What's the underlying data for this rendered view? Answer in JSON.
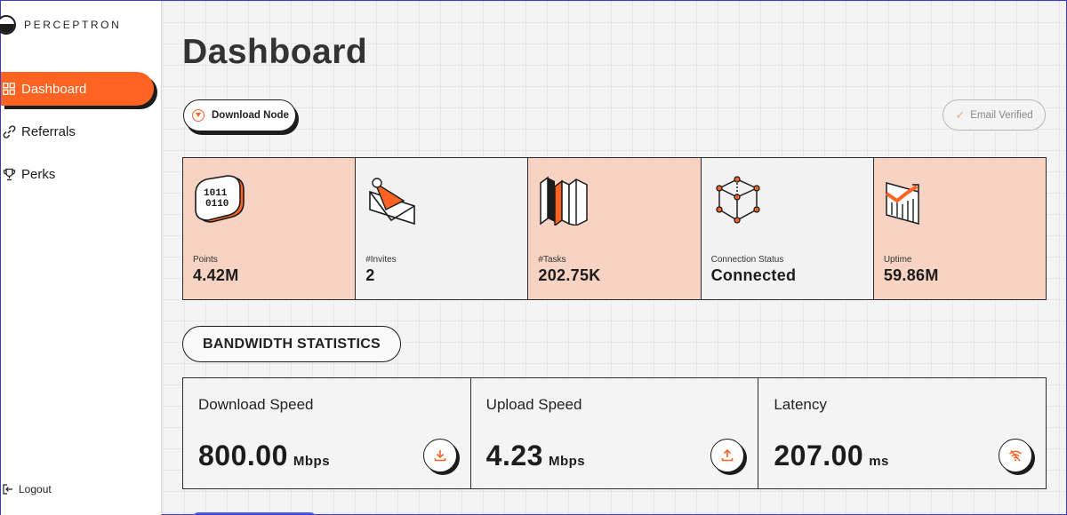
{
  "brand": {
    "name": "PERCEPTRON"
  },
  "nav": {
    "items": [
      {
        "label": "Dashboard",
        "icon": "grid-icon",
        "active": true
      },
      {
        "label": "Referrals",
        "icon": "link-icon",
        "active": false
      },
      {
        "label": "Perks",
        "icon": "trophy-icon",
        "active": false
      }
    ],
    "logout": "Logout"
  },
  "page": {
    "title": "Dashboard"
  },
  "actions": {
    "download_node": "Download Node",
    "email_verified": "Email Verified"
  },
  "stats": [
    {
      "label": "Points",
      "value": "4.42M",
      "icon": "binary-tag-icon"
    },
    {
      "label": "#Invites",
      "value": "2",
      "icon": "envelope-icon"
    },
    {
      "label": "#Tasks",
      "value": "202.75K",
      "icon": "books-icon"
    },
    {
      "label": "Connection Status",
      "value": "Connected",
      "icon": "cube-network-icon"
    },
    {
      "label": "Uptime",
      "value": "59.86M",
      "icon": "chart-trend-icon"
    }
  ],
  "bandwidth": {
    "title": "BANDWIDTH STATISTICS",
    "cards": [
      {
        "label": "Download Speed",
        "value": "800.00",
        "unit": "Mbps",
        "icon": "download-icon"
      },
      {
        "label": "Upload Speed",
        "value": "4.23",
        "unit": "Mbps",
        "icon": "upload-icon"
      },
      {
        "label": "Latency",
        "value": "207.00",
        "unit": "ms",
        "icon": "wifi-off-icon"
      }
    ]
  },
  "colors": {
    "accent": "#ff6322",
    "peach": "#f6d3c3",
    "ink": "#1c1c1c"
  }
}
